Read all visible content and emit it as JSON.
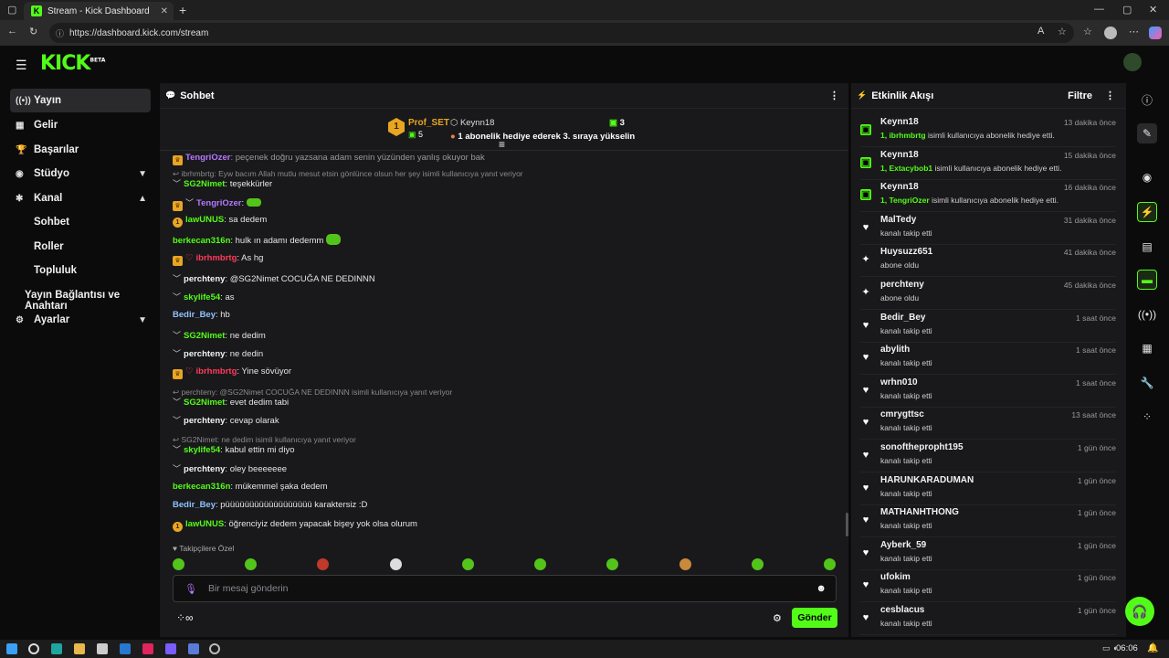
{
  "browser": {
    "tab_title": "Stream - Kick Dashboard",
    "url": "https://dashboard.kick.com/stream"
  },
  "brand": {
    "logo": "KICK",
    "logo_tag": "BETA",
    "accent": "#53fc18"
  },
  "sidebar": {
    "items": [
      {
        "label": "Yayın",
        "icon": "broadcast-icon"
      },
      {
        "label": "Gelir",
        "icon": "revenue-icon"
      },
      {
        "label": "Başarılar",
        "icon": "trophy-icon"
      },
      {
        "label": "Stüdyo",
        "icon": "studio-icon"
      },
      {
        "label": "Kanal",
        "icon": "channel-icon"
      },
      {
        "label": "Sohbet"
      },
      {
        "label": "Roller"
      },
      {
        "label": "Topluluk"
      },
      {
        "label": "Yayın Bağlantısı ve Anahtarı"
      },
      {
        "label": "Ayarlar",
        "icon": "gear-icon"
      }
    ]
  },
  "chat": {
    "title": "Sohbet",
    "pinned": {
      "name1": "Prof_SET",
      "count1": "5",
      "name2": "Keynn18",
      "count2": "3",
      "text": "1 abonelik hediye ederek 3. sıraya yükselin",
      "rank": "1"
    },
    "partial": ": peçenek doğru yazsana adam senin yüzünden yanlış okuyor bak",
    "partial_user": "TengriOzer",
    "messages": [
      {
        "reply": "ibrhmbrtg: Eyw bacım Allah mutlu mesut etsin gönlünce olsun her şey isimli kullanıcıya yanıt veriyor"
      },
      {
        "user": "SG2Nimet",
        "text": ": teşekkürler",
        "color": "#53fc18",
        "badge": "chev"
      },
      {
        "user": "TengriOzer",
        "text": ":",
        "color": "#b678ff",
        "badge": "crown-chev"
      },
      {
        "user": "lawUNUS",
        "text": ": sa dedem",
        "color": "#53fc18",
        "badge": "num"
      },
      {
        "user": "berkecan316n",
        "text": ": hulk ın adamı dedemm",
        "color": "#53fc18",
        "badge": ""
      },
      {
        "user": "ibrhmbrtg",
        "text": ": As hg",
        "color": "#ff3a5a",
        "badge": "crown"
      },
      {
        "user": "perchteny",
        "text": ": @SG2Nimet COCUĞA NE DEDINNN",
        "color": "#f2f2f2",
        "badge": "chev"
      },
      {
        "user": "skylife54",
        "text": ": as",
        "color": "#53fc18",
        "badge": "chev"
      },
      {
        "user": "Bedir_Bey",
        "text": ": hb",
        "color": "#8fc2ff",
        "badge": ""
      },
      {
        "user": "SG2Nimet",
        "text": ": ne dedim",
        "color": "#53fc18",
        "badge": "chev"
      },
      {
        "user": "perchteny",
        "text": ": ne dedin",
        "color": "#f2f2f2",
        "badge": "chev"
      },
      {
        "user": "ibrhmbrtg",
        "text": ": Yine sövüyor",
        "color": "#ff3a5a",
        "badge": "crown"
      },
      {
        "reply": "perchteny: @SG2Nimet COCUĞA NE DEDINNN isimli kullanıcıya yanıt veriyor"
      },
      {
        "user": "SG2Nimet",
        "text": ": evet dedim tabi",
        "color": "#53fc18",
        "badge": "chev"
      },
      {
        "user": "perchteny",
        "text": ": cevap olarak",
        "color": "#f2f2f2",
        "badge": "chev"
      },
      {
        "reply": "SG2Nimet: ne dedim isimli kullanıcıya yanıt veriyor"
      },
      {
        "user": "skylife54",
        "text": ": kabul ettin mi diyo",
        "color": "#53fc18",
        "badge": "chev"
      },
      {
        "user": "perchteny",
        "text": ": oley beeeeeee",
        "color": "#f2f2f2",
        "badge": "chev"
      },
      {
        "user": "berkecan316n",
        "text": ": mükemmel şaka dedem",
        "color": "#53fc18",
        "badge": ""
      },
      {
        "user": "Bedir_Bey",
        "text": ": püüüüüüüüüüüüüüüüüü karaktersiz :D",
        "color": "#8fc2ff",
        "badge": ""
      },
      {
        "user": "lawUNUS",
        "text": ": öğrenciyiz dedem yapacak bişey yok olsa olurum",
        "color": "#53fc18",
        "badge": "num"
      }
    ],
    "followers_label": "Takipçilere Özel",
    "input_placeholder": "Bir mesaj gönderin",
    "send_label": "Gönder"
  },
  "feed": {
    "title": "Etkinlik Akışı",
    "filter_label": "Filtre",
    "events": [
      {
        "name": "Keynn18",
        "desc_hl": "1, ibrhmbrtg",
        "desc": " isimli kullanıcıya abonelik hediye etti.",
        "time": "13 dakika önce",
        "icon": "gift"
      },
      {
        "name": "Keynn18",
        "desc_hl": "1, Extacybob1",
        "desc": " isimli kullanıcıya abonelik hediye etti.",
        "time": "15 dakika önce",
        "icon": "gift"
      },
      {
        "name": "Keynn18",
        "desc_hl": "1, TengriOzer",
        "desc": " isimli kullanıcıya abonelik hediye etti.",
        "time": "16 dakika önce",
        "icon": "gift"
      },
      {
        "name": "MalTedy",
        "desc": "kanalı takip etti",
        "time": "31 dakika önce",
        "icon": "heart"
      },
      {
        "name": "Huysuzz651",
        "desc": "abone oldu",
        "time": "41 dakika önce",
        "icon": "spark"
      },
      {
        "name": "perchteny",
        "desc": "abone oldu",
        "time": "45 dakika önce",
        "icon": "spark"
      },
      {
        "name": "Bedir_Bey",
        "desc": "kanalı takip etti",
        "time": "1 saat önce",
        "icon": "heart"
      },
      {
        "name": "abylith",
        "desc": "kanalı takip etti",
        "time": "1 saat önce",
        "icon": "heart"
      },
      {
        "name": "wrhn010",
        "desc": "kanalı takip etti",
        "time": "1 saat önce",
        "icon": "heart"
      },
      {
        "name": "cmrygttsc",
        "desc": "kanalı takip etti",
        "time": "13 saat önce",
        "icon": "heart"
      },
      {
        "name": "sonofthepropht195",
        "desc": "kanalı takip etti",
        "time": "1 gün önce",
        "icon": "heart"
      },
      {
        "name": "HARUNKARADUMAN",
        "desc": "kanalı takip etti",
        "time": "1 gün önce",
        "icon": "heart"
      },
      {
        "name": "MATHANHTHONG",
        "desc": "kanalı takip etti",
        "time": "1 gün önce",
        "icon": "heart"
      },
      {
        "name": "Ayberk_59",
        "desc": "kanalı takip etti",
        "time": "1 gün önce",
        "icon": "heart"
      },
      {
        "name": "ufokim",
        "desc": "kanalı takip etti",
        "time": "1 gün önce",
        "icon": "heart"
      },
      {
        "name": "cesblacus",
        "desc": "kanalı takip etti",
        "time": "1 gün önce",
        "icon": "heart"
      }
    ]
  },
  "taskbar": {
    "time": "06:06"
  }
}
